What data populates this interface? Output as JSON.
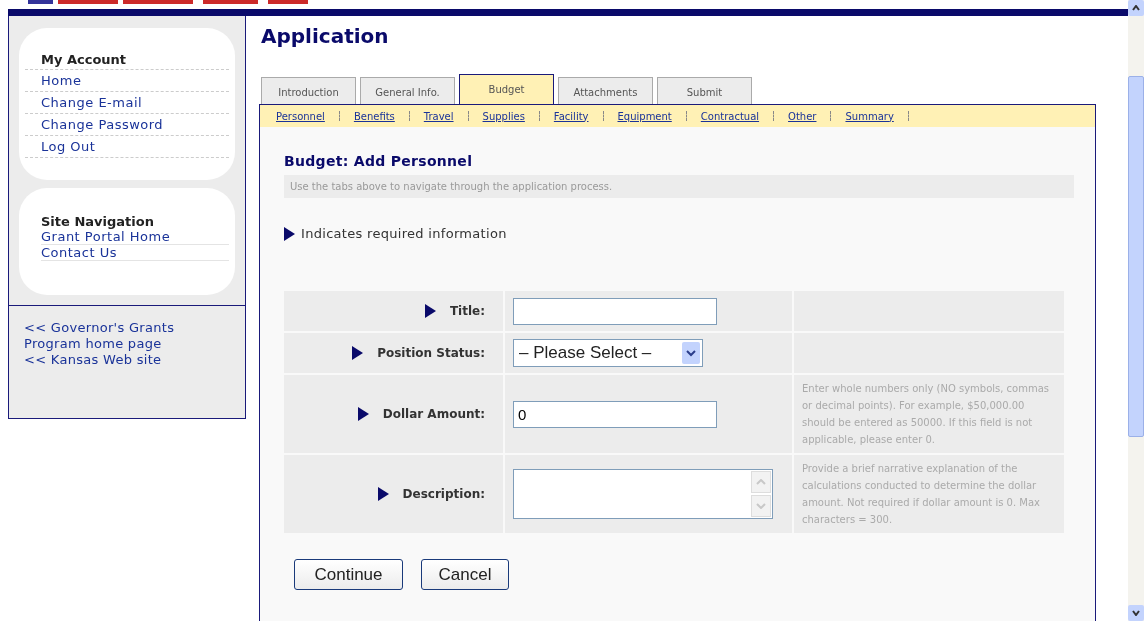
{
  "sidebar": {
    "account": {
      "title": "My Account",
      "links": [
        "Home",
        "Change E-mail",
        "Change Password",
        "Log Out"
      ]
    },
    "navigation": {
      "title": "Site Navigation",
      "links": [
        "Grant Portal Home",
        "Contact Us"
      ]
    },
    "external_links": [
      "<< Governor's Grants Program home page",
      "<< Kansas Web site"
    ]
  },
  "page_title": "Application",
  "tabs": [
    {
      "label": "Introduction",
      "selected": false
    },
    {
      "label": "General Info.",
      "selected": false
    },
    {
      "label": "Budget",
      "selected": true
    },
    {
      "label": "Attachments",
      "selected": false
    },
    {
      "label": "Submit",
      "selected": false
    }
  ],
  "subtabs": [
    "Personnel",
    "Benefits",
    "Travel",
    "Supplies",
    "Facility",
    "Equipment",
    "Contractual",
    "Other",
    "Summary"
  ],
  "heading": "Budget: Add Personnel",
  "instructions": "Use the tabs above to navigate through the application process.",
  "required_note": "Indicates required information",
  "form": {
    "fields": [
      {
        "kind": "text",
        "label": "Title:",
        "required": true
      },
      {
        "kind": "select",
        "label": "Position Status:",
        "required": true,
        "value": "– Please Select –"
      },
      {
        "kind": "text",
        "label": "Dollar Amount:",
        "required": true,
        "value": "0",
        "help": "Enter whole numbers only (NO symbols, commas or decimal points). For example, $50,000.00 should be entered as 50000. If this field is not applicable, please enter 0."
      },
      {
        "kind": "textarea",
        "label": "Description:",
        "required": true,
        "help": "Provide a brief narrative explanation of the calculations conducted to determine the dollar amount. Not required if dollar amount is 0. Max characters = 300."
      }
    ]
  },
  "buttons": [
    "Continue",
    "Cancel"
  ]
}
